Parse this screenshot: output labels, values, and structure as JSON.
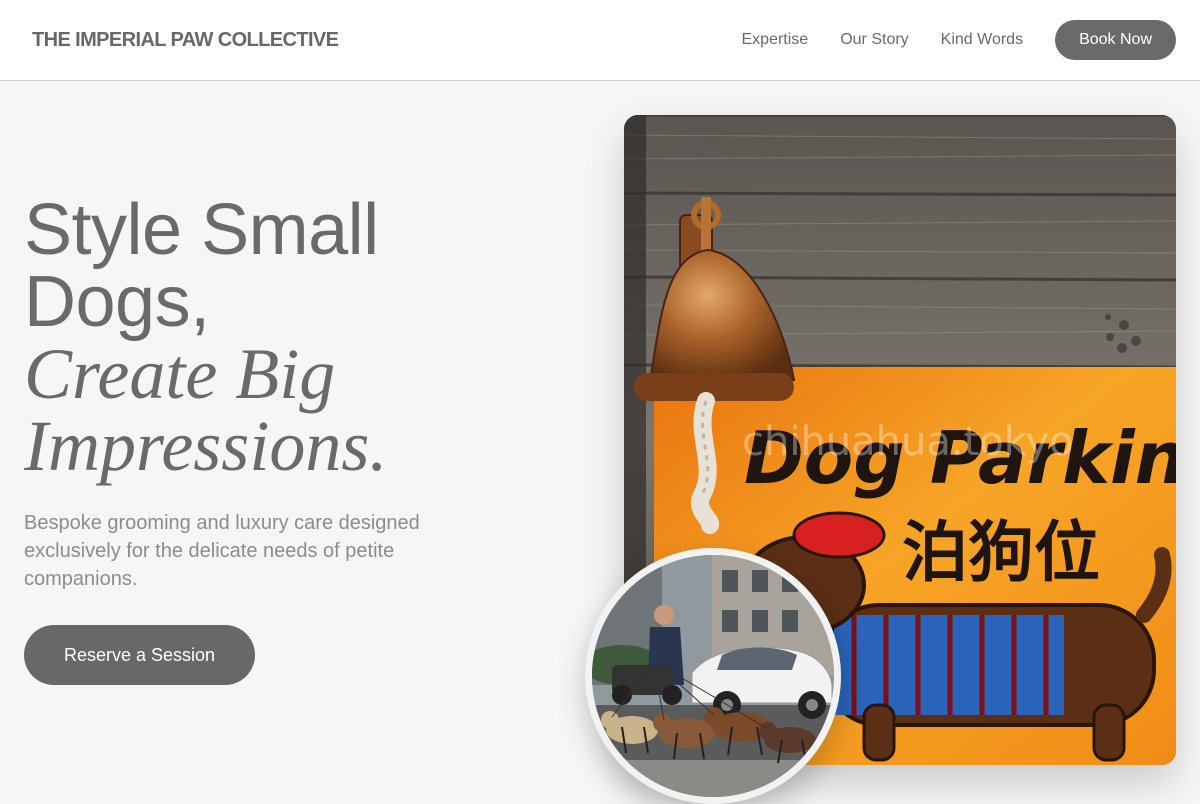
{
  "brand": {
    "name": "THE IMPERIAL PAW COLLECTIVE"
  },
  "nav": {
    "links": [
      "Expertise",
      "Our Story",
      "Kind Words"
    ],
    "cta_label": "Book Now"
  },
  "hero": {
    "title_line_1": "Style Small",
    "title_line_2": "Dogs,",
    "title_line_3": "Create Big",
    "title_line_4": "Impressions.",
    "subtitle": "Bespoke grooming and luxury care designed exclusively for the delicate needs of petite companions.",
    "cta_label": "Reserve a Session"
  },
  "main_image": {
    "sign_text": "Dog Parking",
    "sign_text_cjk": "泊狗位",
    "watermark": "chihuahua.tokyo"
  },
  "colors": {
    "text_gray": "#6a6a6a",
    "button_gray": "#686868",
    "background": "#f6f6f6",
    "sign_orange": "#f39a1c"
  }
}
